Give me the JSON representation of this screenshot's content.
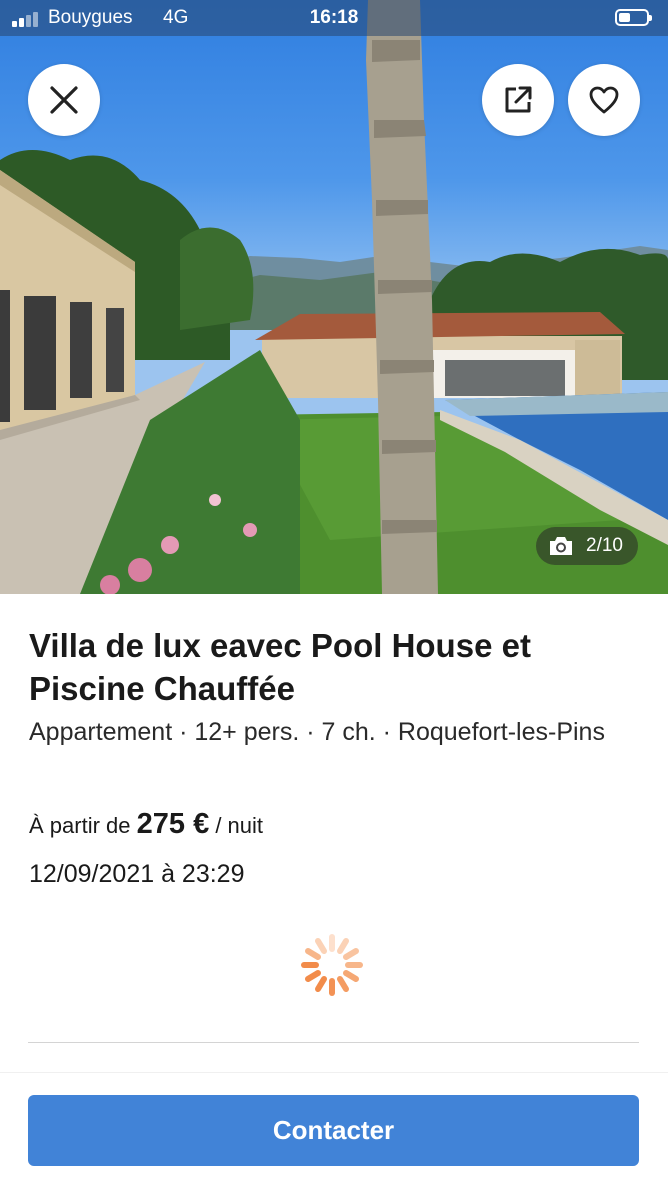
{
  "status_bar": {
    "carrier": "Bouygues",
    "network": "4G",
    "time": "16:18"
  },
  "hero": {
    "photo_counter": "2/10",
    "icons": {
      "close": "close-icon",
      "share": "external-link-icon",
      "favorite": "heart-icon",
      "camera": "camera-icon"
    }
  },
  "listing": {
    "title": "Villa de lux eavec Pool House et Piscine Chauffée",
    "subtitle": "Appartement · 12+ pers. · 7 ch. · Roquefort-les-Pins",
    "price_prefix": "À partir de",
    "price_amount": "275 €",
    "price_suffix": "/ nuit",
    "date": "12/09/2021 à 23:29"
  },
  "actions": {
    "contact_label": "Contacter"
  },
  "colors": {
    "primary": "#4183d7",
    "spinner": "#f28c4b"
  }
}
